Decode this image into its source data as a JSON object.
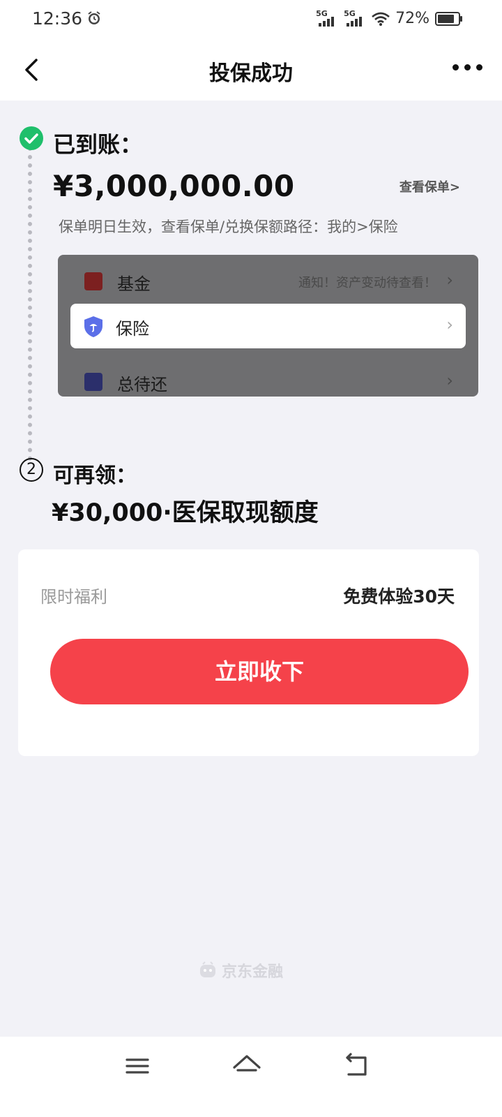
{
  "status_bar": {
    "time": "12:36",
    "network_1": "5G",
    "network_2": "5G",
    "battery_percent": "72%",
    "battery_level": 0.72,
    "icons": [
      "alarm-icon",
      "signal-icon",
      "signal-icon",
      "wifi-icon",
      "battery-icon"
    ]
  },
  "nav": {
    "title": "投保成功",
    "back_icon": "chevron-left-icon",
    "more_icon": "more-horizontal-icon"
  },
  "step1": {
    "icon": "check-circle-icon",
    "title": "已到账：",
    "amount": "¥3,000,000.00",
    "view_policy": "查看保单>",
    "hint": "保单明日生效，查看保单/兑换保额路径：我的>保险"
  },
  "menu_preview": {
    "items": [
      {
        "label": "基金",
        "note": "通知！资产变动待查看！",
        "chevron": "›",
        "icon": "fund-chart-icon"
      },
      {
        "label": "保险",
        "note": "",
        "chevron": "›",
        "icon": "insurance-shield-icon"
      },
      {
        "label": "总待还",
        "note": "",
        "chevron": "›",
        "icon": "repayment-icon"
      }
    ]
  },
  "step2": {
    "number": "2",
    "title": "可再领：",
    "value": "¥30,000·医保取现额度"
  },
  "welfare": {
    "label": "限时福利",
    "offer": "免费体验30天",
    "button": "立即收下"
  },
  "footer": {
    "brand": "京东金融",
    "brand_icon": "jd-finance-logo-icon"
  },
  "system_nav": {
    "icons": [
      "menu-icon",
      "home-icon",
      "back-icon"
    ]
  },
  "colors": {
    "accent_red": "#f5424a",
    "success_green": "#1fbf6b",
    "shield_blue": "#5b6fe8",
    "background": "#f2f2f7"
  }
}
